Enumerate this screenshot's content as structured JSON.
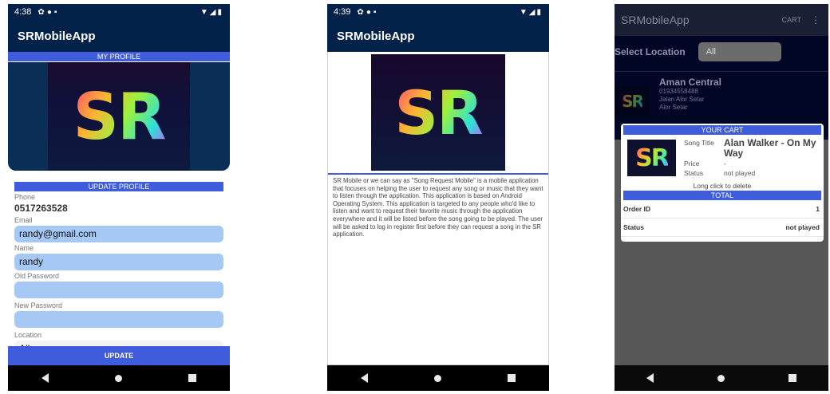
{
  "app_name": "SRMobileApp",
  "logo_text": "SR",
  "phone1": {
    "status": {
      "time": "4:38"
    },
    "section_title": "MY PROFILE",
    "update_title": "UPDATE PROFILE",
    "phone_label": "Phone",
    "phone_value": "0517263528",
    "email_label": "Email",
    "email_value": "randy@gmail.com",
    "name_label": "Name",
    "name_value": "randy",
    "old_password_label": "Old Password",
    "old_password_value": "",
    "new_password_label": "New Password",
    "new_password_value": "",
    "location_label": "Location",
    "location_value": "All",
    "update_button": "UPDATE"
  },
  "phone2": {
    "status": {
      "time": "4:39"
    },
    "about": "SR Mobile or we can say as \"Song Request Mobile\" is a mobile application that focuses on helping the user to request any song or music that they want to listen through the application. This application is based on Android Operating System. This application is targeted to any people who'd like to listen and want to request their favorite music through the application everywhere and it will be listed before the song going to be played. The user will be asked to log in register first before they can request a song in the SR application."
  },
  "phone3": {
    "cart_menu": "CART",
    "select_location_label": "Select Location",
    "select_location_value": "All",
    "location_item": {
      "name": "Aman Central",
      "phone": "01934558488",
      "address1": "Jalan Alor Setar",
      "address2": "Alor Setar"
    },
    "dialog": {
      "title": "YOUR CART",
      "song_title_label": "Song Title",
      "song_title_value": "Alan Walker - On My Way",
      "price_label": "Price",
      "price_value": "-",
      "status_label": "Status",
      "status_value": "not played",
      "hint": "Long click to delete",
      "total_title": "TOTAL",
      "order_id_label": "Order ID",
      "order_id_value": "1",
      "order_status_label": "Status",
      "order_status_value": "not played"
    }
  },
  "colors": {
    "primary_dark": "#03224a",
    "accent": "#3e5cdc",
    "input_bg": "#a6c8f5"
  },
  "icons": [
    "settings-icon",
    "shield-icon",
    "sdcard-icon",
    "wifi-icon",
    "signal-icon",
    "battery-icon",
    "back-icon",
    "home-icon",
    "recents-icon",
    "more-vert-icon"
  ]
}
